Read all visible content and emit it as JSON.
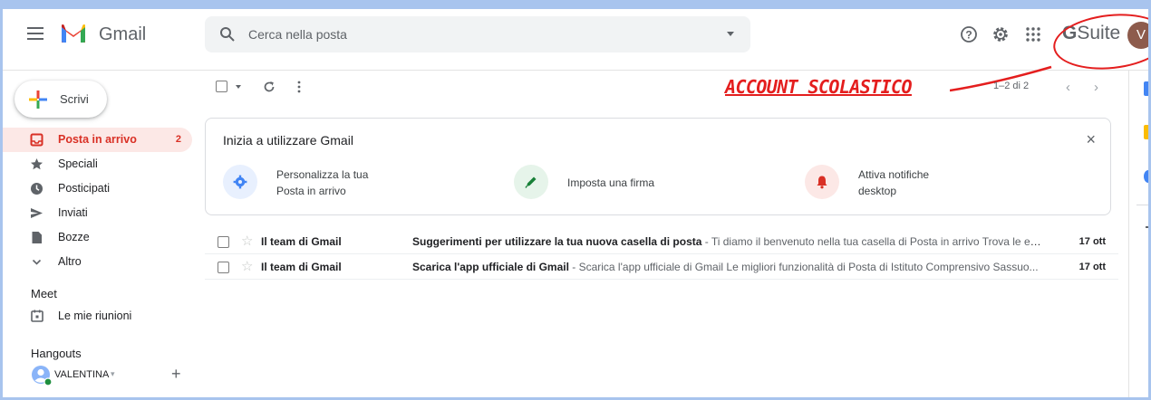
{
  "header": {
    "app_name": "Gmail",
    "search_placeholder": "Cerca nella posta",
    "suite_g": "G",
    "suite_word": "Suite",
    "avatar_initial": "V"
  },
  "annotation": {
    "text": "ACCOUNT SCOLASTICO",
    "color": "#e41e1e"
  },
  "sidebar": {
    "compose_label": "Scrivi",
    "items": [
      {
        "label": "Posta in arrivo",
        "count": "2",
        "icon": "inbox-icon",
        "active": true
      },
      {
        "label": "Speciali",
        "icon": "star-icon"
      },
      {
        "label": "Posticipati",
        "icon": "clock-icon"
      },
      {
        "label": "Inviati",
        "icon": "send-icon"
      },
      {
        "label": "Bozze",
        "icon": "draft-icon"
      },
      {
        "label": "Altro",
        "icon": "chevron-down-icon"
      }
    ],
    "meet_title": "Meet",
    "meet_item": "Le mie riunioni",
    "hangouts_title": "Hangouts",
    "hangouts_user": "VALENTINA",
    "hangouts_caret": "▾",
    "hangouts_add": "+"
  },
  "toolbar": {
    "pager": "1–2 di 2",
    "prev": "‹",
    "next": "›"
  },
  "getting_started": {
    "title": "Inizia a utilizzare Gmail",
    "close": "×",
    "tips": [
      {
        "text": "Personalizza la tua Posta in arrivo",
        "icon": "gear-icon",
        "color": "#4285f4",
        "bg": "#e8f0fe"
      },
      {
        "text": "Imposta una firma",
        "icon": "pen-icon",
        "color": "#188038",
        "bg": "#e6f4ea"
      },
      {
        "text": "Attiva notifiche desktop",
        "icon": "bell-icon",
        "color": "#d93025",
        "bg": "#fce8e6"
      }
    ]
  },
  "emails": [
    {
      "from": "Il team di Gmail",
      "subject": "Suggerimenti per utilizzare la tua nuova casella di posta",
      "snippet": " - Ti diamo il benvenuto nella tua casella di Posta in arrivo Trova le em...",
      "date": "17 ott"
    },
    {
      "from": "Il team di Gmail",
      "subject": "Scarica l'app ufficiale di Gmail",
      "snippet": " - Scarica l'app ufficiale di Gmail Le migliori funzionalità di Posta di Istituto Comprensivo Sassuo...",
      "date": "17 ott"
    }
  ],
  "colors": {
    "accent_red": "#d93025",
    "active_bg": "#fce8e6",
    "frame": "#a8c4ee"
  }
}
